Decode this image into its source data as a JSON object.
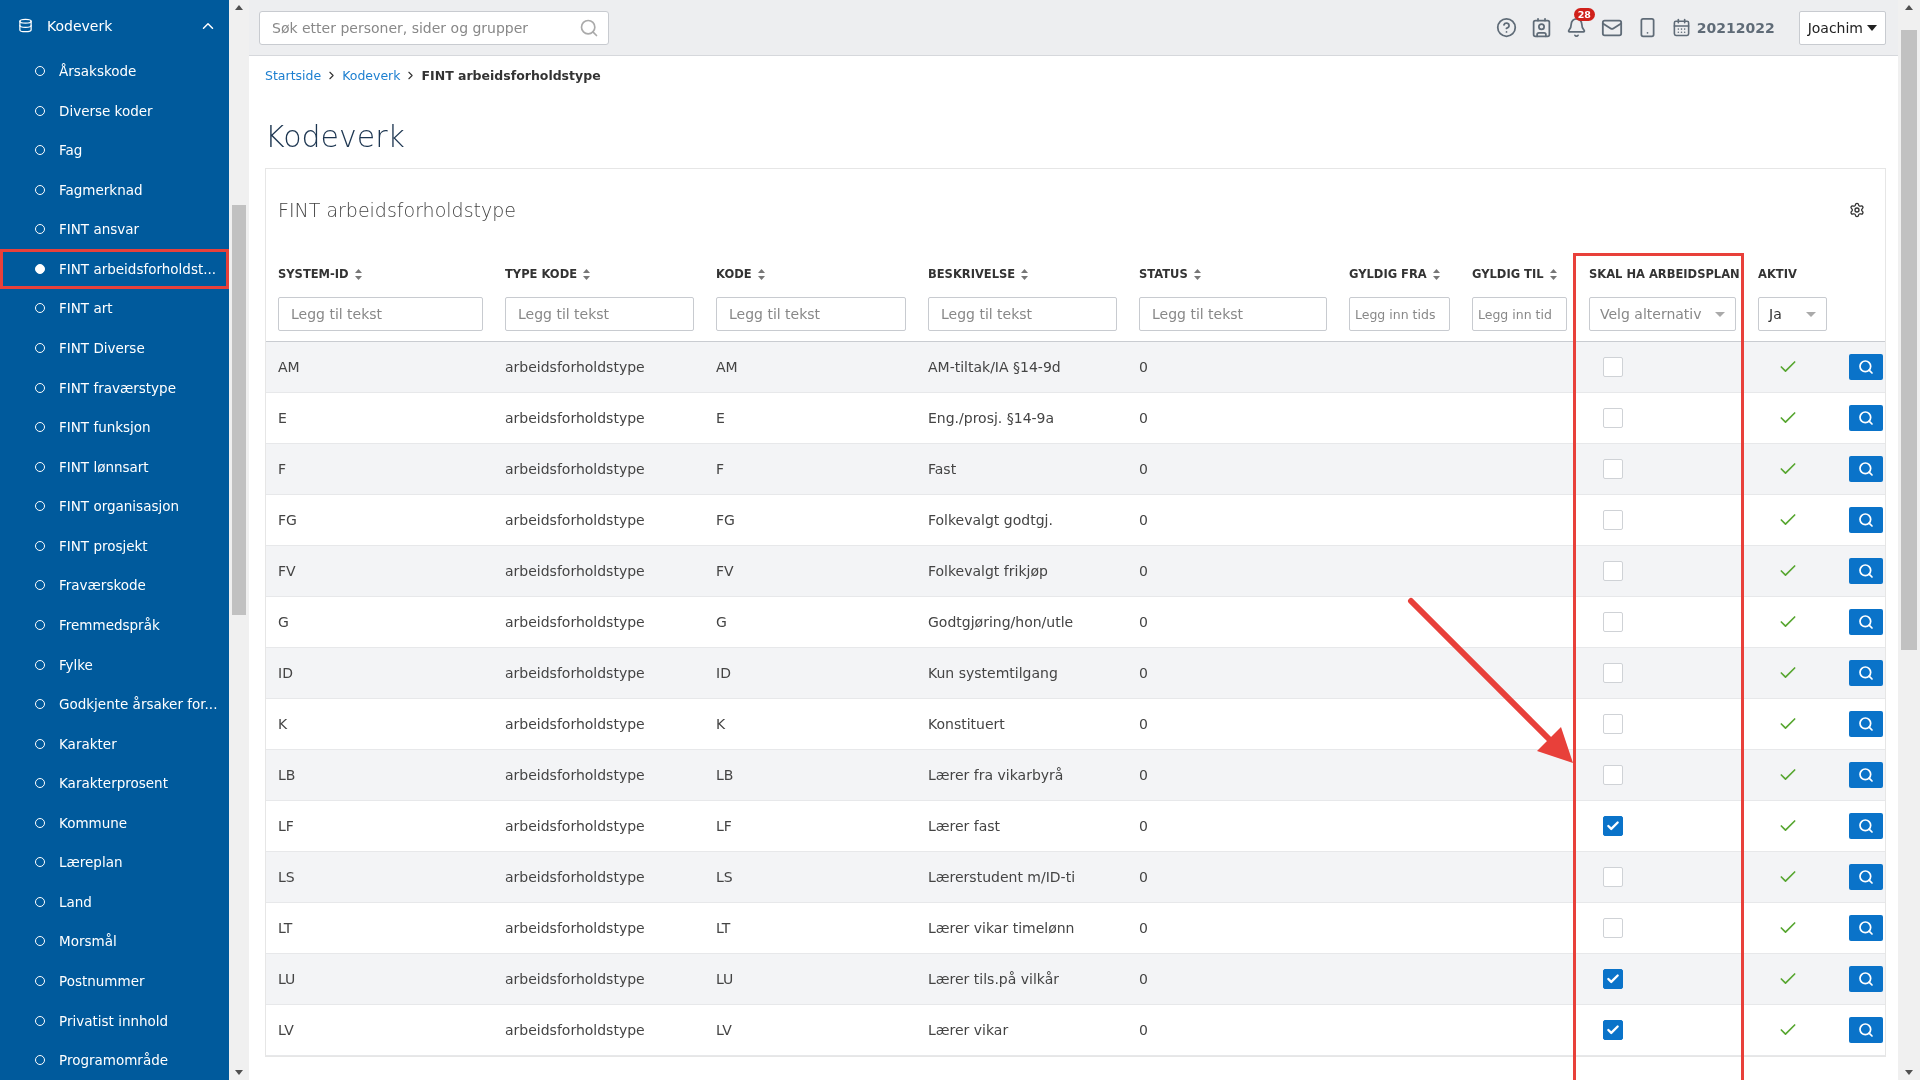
{
  "sidebar": {
    "header": "Kodeverk",
    "items": [
      {
        "label": "Årsakskode",
        "selected": false,
        "highlighted": false
      },
      {
        "label": "Diverse koder",
        "selected": false,
        "highlighted": false
      },
      {
        "label": "Fag",
        "selected": false,
        "highlighted": false
      },
      {
        "label": "Fagmerknad",
        "selected": false,
        "highlighted": false
      },
      {
        "label": "FINT ansvar",
        "selected": false,
        "highlighted": false
      },
      {
        "label": "FINT arbeidsforholdst...",
        "selected": true,
        "highlighted": true
      },
      {
        "label": "FINT art",
        "selected": false,
        "highlighted": false
      },
      {
        "label": "FINT Diverse",
        "selected": false,
        "highlighted": false
      },
      {
        "label": "FINT fraværstype",
        "selected": false,
        "highlighted": false
      },
      {
        "label": "FINT funksjon",
        "selected": false,
        "highlighted": false
      },
      {
        "label": "FINT lønnsart",
        "selected": false,
        "highlighted": false
      },
      {
        "label": "FINT organisasjon",
        "selected": false,
        "highlighted": false
      },
      {
        "label": "FINT prosjekt",
        "selected": false,
        "highlighted": false
      },
      {
        "label": "Fraværskode",
        "selected": false,
        "highlighted": false
      },
      {
        "label": "Fremmedspråk",
        "selected": false,
        "highlighted": false
      },
      {
        "label": "Fylke",
        "selected": false,
        "highlighted": false
      },
      {
        "label": "Godkjente årsaker for...",
        "selected": false,
        "highlighted": false
      },
      {
        "label": "Karakter",
        "selected": false,
        "highlighted": false
      },
      {
        "label": "Karakterprosent",
        "selected": false,
        "highlighted": false
      },
      {
        "label": "Kommune",
        "selected": false,
        "highlighted": false
      },
      {
        "label": "Læreplan",
        "selected": false,
        "highlighted": false
      },
      {
        "label": "Land",
        "selected": false,
        "highlighted": false
      },
      {
        "label": "Morsmål",
        "selected": false,
        "highlighted": false
      },
      {
        "label": "Postnummer",
        "selected": false,
        "highlighted": false
      },
      {
        "label": "Privatist innhold",
        "selected": false,
        "highlighted": false
      },
      {
        "label": "Programområde",
        "selected": false,
        "highlighted": false
      }
    ]
  },
  "topbar": {
    "search": {
      "placeholder": "Søk etter personer, sider og grupper"
    },
    "notification_count": "28",
    "school_year": "20212022",
    "user": "Joachim"
  },
  "breadcrumb": [
    {
      "label": "Startside",
      "link": true
    },
    {
      "label": "Kodeverk",
      "link": true
    },
    {
      "label": "FINT arbeidsforholdstype",
      "link": false
    }
  ],
  "page_title": "Kodeverk",
  "card": {
    "title": "FINT arbeidsforholdstype",
    "columns": [
      {
        "label": "SYSTEM-ID",
        "sortable": true,
        "highlighted": false
      },
      {
        "label": "TYPE KODE",
        "sortable": true,
        "highlighted": false
      },
      {
        "label": "KODE",
        "sortable": true,
        "highlighted": false
      },
      {
        "label": "BESKRIVELSE",
        "sortable": true,
        "highlighted": false
      },
      {
        "label": "STATUS",
        "sortable": true,
        "highlighted": false
      },
      {
        "label": "GYLDIG FRA",
        "sortable": true,
        "highlighted": false
      },
      {
        "label": "GYLDIG TIL",
        "sortable": true,
        "highlighted": false
      },
      {
        "label": "SKAL HA ARBEIDSPLAN",
        "sortable": false,
        "highlighted": true
      },
      {
        "label": "AKTIV",
        "sortable": false,
        "highlighted": false
      }
    ],
    "filters": [
      {
        "kind": "text",
        "placeholder": "Legg til tekst"
      },
      {
        "kind": "text",
        "placeholder": "Legg til tekst"
      },
      {
        "kind": "text",
        "placeholder": "Legg til tekst"
      },
      {
        "kind": "text",
        "placeholder": "Legg til tekst"
      },
      {
        "kind": "text",
        "placeholder": "Legg til tekst"
      },
      {
        "kind": "text",
        "placeholder": "Legg inn tids"
      },
      {
        "kind": "text",
        "placeholder": "Legg inn tid"
      },
      {
        "kind": "select",
        "placeholder": "Velg alternativ"
      },
      {
        "kind": "select",
        "value": "Ja"
      }
    ],
    "rows": [
      {
        "system_id": "AM",
        "type_kode": "arbeidsforholdstype",
        "kode": "AM",
        "beskrivelse": "AM-tiltak/IA §14-9d",
        "status": "0",
        "arbeidsplan": false,
        "aktiv": true
      },
      {
        "system_id": "E",
        "type_kode": "arbeidsforholdstype",
        "kode": "E",
        "beskrivelse": "Eng./prosj. §14-9a",
        "status": "0",
        "arbeidsplan": false,
        "aktiv": true
      },
      {
        "system_id": "F",
        "type_kode": "arbeidsforholdstype",
        "kode": "F",
        "beskrivelse": "Fast",
        "status": "0",
        "arbeidsplan": false,
        "aktiv": true
      },
      {
        "system_id": "FG",
        "type_kode": "arbeidsforholdstype",
        "kode": "FG",
        "beskrivelse": "Folkevalgt godtgj.",
        "status": "0",
        "arbeidsplan": false,
        "aktiv": true
      },
      {
        "system_id": "FV",
        "type_kode": "arbeidsforholdstype",
        "kode": "FV",
        "beskrivelse": "Folkevalgt frikjøp",
        "status": "0",
        "arbeidsplan": false,
        "aktiv": true
      },
      {
        "system_id": "G",
        "type_kode": "arbeidsforholdstype",
        "kode": "G",
        "beskrivelse": "Godtgjøring/hon/utle",
        "status": "0",
        "arbeidsplan": false,
        "aktiv": true
      },
      {
        "system_id": "ID",
        "type_kode": "arbeidsforholdstype",
        "kode": "ID",
        "beskrivelse": "Kun systemtilgang",
        "status": "0",
        "arbeidsplan": false,
        "aktiv": true
      },
      {
        "system_id": "K",
        "type_kode": "arbeidsforholdstype",
        "kode": "K",
        "beskrivelse": "Konstituert",
        "status": "0",
        "arbeidsplan": false,
        "aktiv": true
      },
      {
        "system_id": "LB",
        "type_kode": "arbeidsforholdstype",
        "kode": "LB",
        "beskrivelse": "Lærer fra vikarbyrå",
        "status": "0",
        "arbeidsplan": false,
        "aktiv": true
      },
      {
        "system_id": "LF",
        "type_kode": "arbeidsforholdstype",
        "kode": "LF",
        "beskrivelse": "Lærer fast",
        "status": "0",
        "arbeidsplan": true,
        "aktiv": true
      },
      {
        "system_id": "LS",
        "type_kode": "arbeidsforholdstype",
        "kode": "LS",
        "beskrivelse": "Lærerstudent m/ID-ti",
        "status": "0",
        "arbeidsplan": false,
        "aktiv": true
      },
      {
        "system_id": "LT",
        "type_kode": "arbeidsforholdstype",
        "kode": "LT",
        "beskrivelse": "Lærer vikar timelønn",
        "status": "0",
        "arbeidsplan": false,
        "aktiv": true
      },
      {
        "system_id": "LU",
        "type_kode": "arbeidsforholdstype",
        "kode": "LU",
        "beskrivelse": "Lærer tils.på vilkår",
        "status": "0",
        "arbeidsplan": true,
        "aktiv": true
      },
      {
        "system_id": "LV",
        "type_kode": "arbeidsforholdstype",
        "kode": "LV",
        "beskrivelse": "Lærer vikar",
        "status": "0",
        "arbeidsplan": true,
        "aktiv": true
      }
    ]
  },
  "annotation": {
    "kind": "arrow"
  }
}
